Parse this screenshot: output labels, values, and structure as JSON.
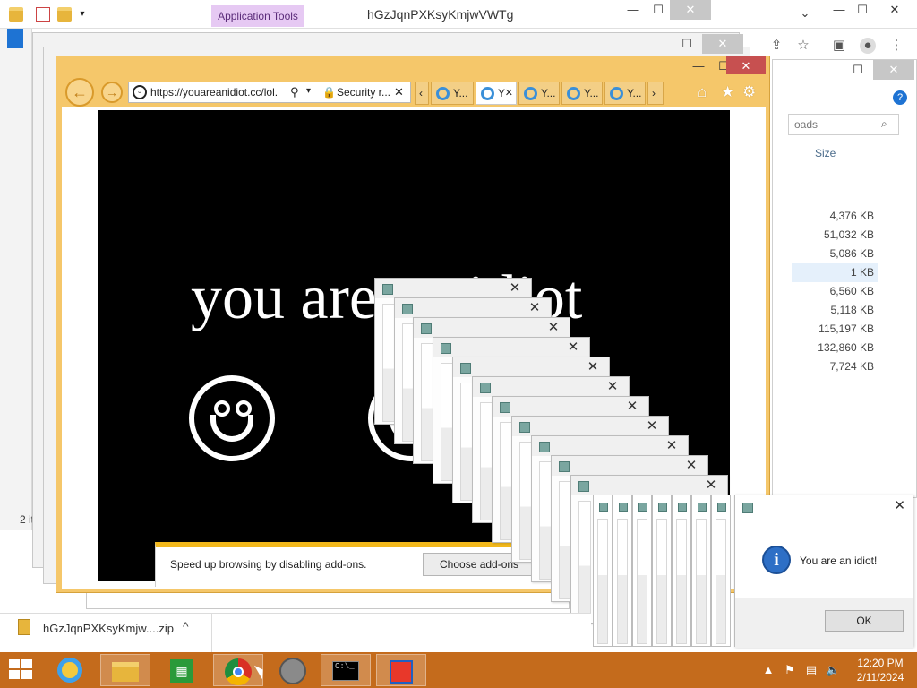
{
  "explorer": {
    "app_tools": "Application Tools",
    "title": "hGzJqnPXKsyKmjwVWTg",
    "status": "2 it",
    "caption": {
      "minimize": "—",
      "maximize": "☐",
      "close": "✕"
    }
  },
  "downloads": {
    "search_placeholder": "oads",
    "size_header": "Size",
    "sizes": [
      "4,376 KB",
      "51,032 KB",
      "5,086 KB",
      "1 KB",
      "6,560 KB",
      "5,118 KB",
      "115,197 KB",
      "132,860 KB",
      "7,724 KB"
    ]
  },
  "ie": {
    "url": "https://youareanidiot.cc/lol.",
    "security": "Security r...",
    "tabs": [
      "Y...",
      "Y",
      "Y...",
      "Y...",
      "Y..."
    ],
    "page_text": "you are an idiot",
    "addons": {
      "message": "Speed up browsing by disabling add-ons.",
      "button": "Choose add-ons"
    }
  },
  "dialog": {
    "message": "You are an idiot!",
    "ok": "OK",
    "close": "✕"
  },
  "shelf": {
    "filename": "hGzJqnPXKsyKmjw....zip",
    "chevron": "^"
  },
  "taskbar": {
    "time": "12:20 PM",
    "date": "2/11/2024",
    "accent": "#c46b1c"
  }
}
